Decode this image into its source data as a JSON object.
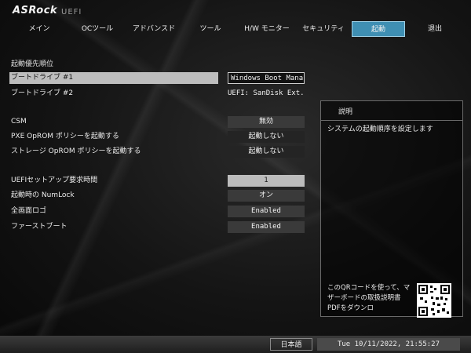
{
  "header": {
    "logo": "ASRock",
    "subtitle": "UEFI"
  },
  "nav": {
    "tabs": [
      {
        "label": "メイン",
        "active": false
      },
      {
        "label": "OCツール",
        "active": false
      },
      {
        "label": "アドバンスド",
        "active": false
      },
      {
        "label": "ツール",
        "active": false
      },
      {
        "label": "H/W モニター",
        "active": false
      },
      {
        "label": "セキュリティ",
        "active": false
      },
      {
        "label": "起動",
        "active": true
      },
      {
        "label": "退出",
        "active": false
      }
    ]
  },
  "main": {
    "section_title": "起動優先順位",
    "boot_drive_1": {
      "label": "ブートドライブ #1",
      "value": "Windows Boot Mana..."
    },
    "boot_drive_2": {
      "label": "ブートドライブ #2",
      "value": "UEFI: SanDisk Ext..."
    },
    "csm": {
      "label": "CSM",
      "value": "無効"
    },
    "pxe": {
      "label": "PXE OpROM ポリシーを起動する",
      "value": "起動しない"
    },
    "storage": {
      "label": "ストレージ OpROM ポリシーを起動する",
      "value": "起動しない"
    },
    "setup_time": {
      "label": "UEFIセットアップ要求時間",
      "value": "1"
    },
    "numlock": {
      "label": "起動時の NumLock",
      "value": "オン"
    },
    "fullscreen_logo": {
      "label": "全画面ロゴ",
      "value": "Enabled"
    },
    "fast_boot": {
      "label": "ファーストブート",
      "value": "Enabled"
    }
  },
  "description": {
    "title": "説明",
    "text": "システムの起動順序を設定します",
    "qr_text": "このQRコードを使って、マザーボードの取扱説明書PDFをダウンロ"
  },
  "footer": {
    "language": "日本語",
    "datetime": "Tue 10/11/2022, 21:55:27"
  },
  "colors": {
    "active_tab": "#3f8fb3",
    "background": "#141414"
  }
}
